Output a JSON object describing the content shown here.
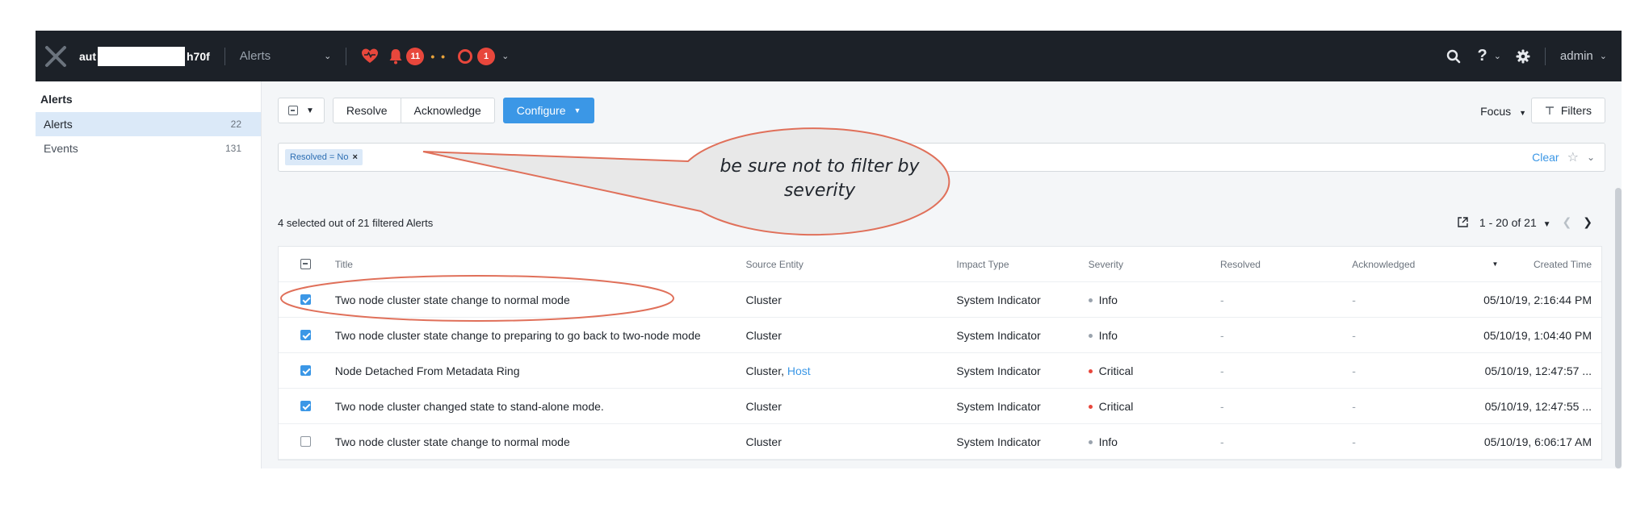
{
  "topbar": {
    "cluster_prefix": "aut",
    "cluster_suffix": "h70f",
    "section": "Alerts",
    "alert_count": "11",
    "critical_count": "1",
    "user": "admin"
  },
  "sidebar": {
    "header": "Alerts",
    "items": [
      {
        "label": "Alerts",
        "count": "22"
      },
      {
        "label": "Events",
        "count": "131"
      }
    ]
  },
  "toolbar": {
    "resolve_label": "Resolve",
    "acknowledge_label": "Acknowledge",
    "configure_label": "Configure",
    "focus_label": "Focus",
    "filters_label": "Filters"
  },
  "search": {
    "chip_label": "Resolved = No",
    "clear_label": "Clear"
  },
  "summary": "4 selected out of 21 filtered Alerts",
  "pager": {
    "range": "1 - 20 of 21"
  },
  "table": {
    "columns": [
      "Title",
      "Source Entity",
      "Impact Type",
      "Severity",
      "Resolved",
      "Acknowledged",
      "Created Time"
    ],
    "rows": [
      {
        "checked": true,
        "title": "Two node cluster state change to normal mode",
        "source": "Cluster",
        "source_link": "",
        "impact": "System Indicator",
        "severity": "Info",
        "resolved": "-",
        "acknowledged": "-",
        "created": "05/10/19, 2:16:44 PM"
      },
      {
        "checked": true,
        "title": "Two node cluster state change to preparing to go back to two-node mode",
        "source": "Cluster",
        "source_link": "",
        "impact": "System Indicator",
        "severity": "Info",
        "resolved": "-",
        "acknowledged": "-",
        "created": "05/10/19, 1:04:40 PM"
      },
      {
        "checked": true,
        "title": "Node Detached From Metadata Ring",
        "source": "Cluster,",
        "source_link": "Host",
        "impact": "System Indicator",
        "severity": "Critical",
        "resolved": "-",
        "acknowledged": "-",
        "created": "05/10/19, 12:47:57 ..."
      },
      {
        "checked": true,
        "title": "Two node cluster changed state to stand-alone mode.",
        "source": "Cluster",
        "source_link": "",
        "impact": "System Indicator",
        "severity": "Critical",
        "resolved": "-",
        "acknowledged": "-",
        "created": "05/10/19, 12:47:55 ..."
      },
      {
        "checked": false,
        "title": "Two node cluster state change to normal mode",
        "source": "Cluster",
        "source_link": "",
        "impact": "System Indicator",
        "severity": "Info",
        "resolved": "-",
        "acknowledged": "-",
        "created": "05/10/19, 6:06:17 AM"
      }
    ]
  },
  "annotation": {
    "callout_line1": "be sure not to filter by",
    "callout_line2": "severity"
  },
  "colors": {
    "topbar_bg": "#1c2128",
    "accent": "#3b97e6",
    "critical": "#e8473c",
    "info": "#9aa3ad",
    "annotation_red": "#e0705a",
    "callout_fill": "#e8e8e8"
  }
}
